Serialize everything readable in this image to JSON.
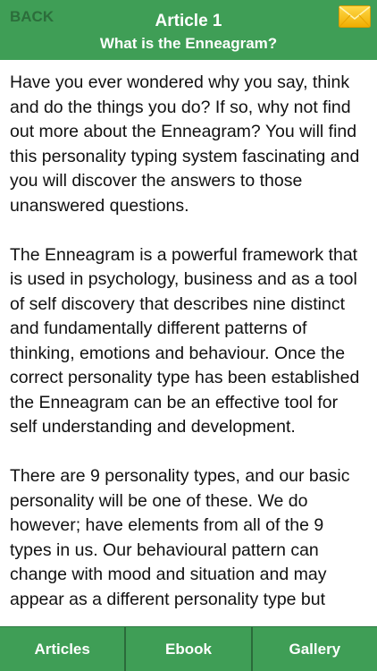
{
  "header": {
    "back_label": "BACK",
    "title": "Article 1",
    "subtitle": "What is the Enneagram?",
    "mail_icon": "envelope-icon"
  },
  "article": {
    "paragraphs": [
      "Have you ever wondered why you say, think and do the things you do? If so, why not find out more about the Enneagram? You will find this personality typing system fascinating and you will discover the answers to those unanswered questions.",
      "The Enneagram is a powerful framework that is used in psychology, business and as a tool of self discovery that describes nine distinct and fundamentally different patterns of thinking, emotions and behaviour. Once the correct personality type has been established the Enneagram can be an effective tool for self understanding and development.",
      "There are 9 personality types, and our basic personality will be one of these. We do however; have elements from all of the 9 types in us. Our behavioural pattern can change with mood and situation and may appear as a different personality type but"
    ]
  },
  "tabs": [
    {
      "label": "Articles"
    },
    {
      "label": "Ebook"
    },
    {
      "label": "Gallery"
    }
  ],
  "colors": {
    "bar_green": "#3f9e56",
    "back_text": "#2c6d3b",
    "envelope": "#f6c41a"
  }
}
